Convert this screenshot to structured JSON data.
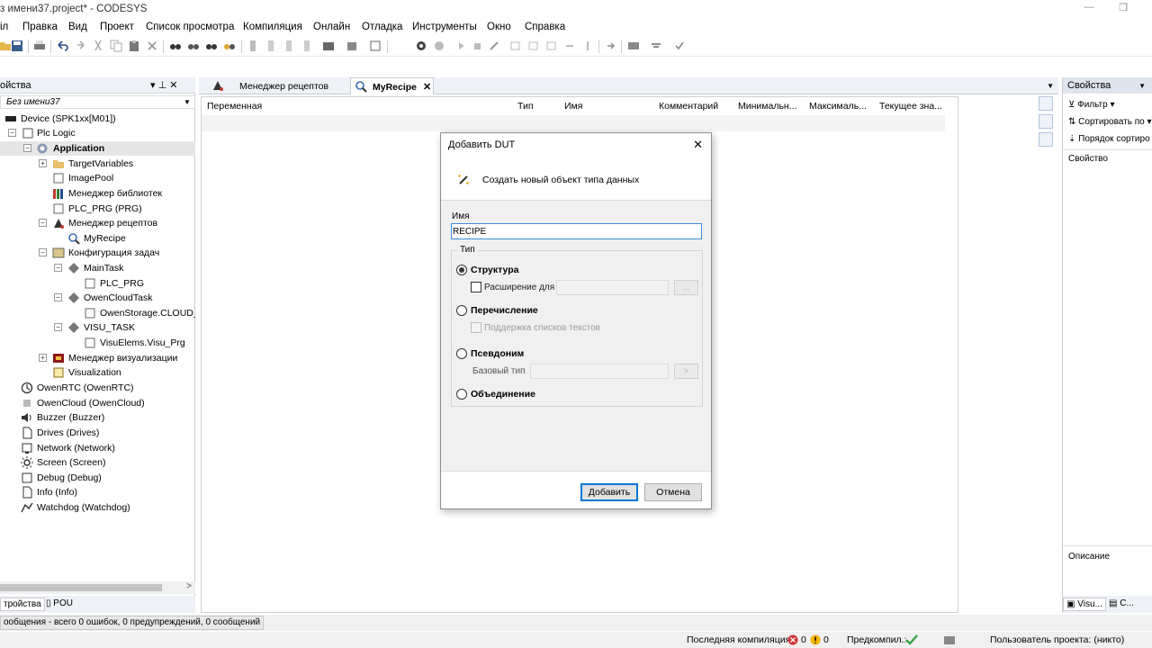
{
  "window": {
    "title": "з имени37.project* - CODESYS",
    "minimize": "—",
    "restore": "❐"
  },
  "menu": [
    "іл",
    "Правка",
    "Вид",
    "Проект",
    "Список просмотра",
    "Компиляция",
    "Онлайн",
    "Отладка",
    "Инструменты",
    "Окно",
    "Справка"
  ],
  "left_pane": {
    "title": "ойства",
    "pin": "▾  ⊥  ✕",
    "tree_root": "Без имени37",
    "nodes": [
      {
        "label": "Device (SPK1xx[M01])"
      },
      {
        "label": "Plc Logic"
      },
      {
        "label": "Application"
      },
      {
        "label": "TargetVariables"
      },
      {
        "label": "ImagePool"
      },
      {
        "label": "Менеджер библиотек"
      },
      {
        "label": "PLC_PRG (PRG)"
      },
      {
        "label": "Менеджер рецептов"
      },
      {
        "label": "MyRecipe"
      },
      {
        "label": "Конфигурация задач"
      },
      {
        "label": "MainTask"
      },
      {
        "label": "PLC_PRG"
      },
      {
        "label": "OwenCloudTask"
      },
      {
        "label": "OwenStorage.CLOUD_PR"
      },
      {
        "label": "VISU_TASK"
      },
      {
        "label": "VisuElems.Visu_Prg"
      },
      {
        "label": "Менеджер визуализации"
      },
      {
        "label": "Visualization"
      },
      {
        "label": "OwenRTC (OwenRTC)"
      },
      {
        "label": "OwenCloud (OwenCloud)"
      },
      {
        "label": "Buzzer (Buzzer)"
      },
      {
        "label": "Drives (Drives)"
      },
      {
        "label": "Network (Network)"
      },
      {
        "label": "Screen (Screen)"
      },
      {
        "label": "Debug (Debug)"
      },
      {
        "label": "Info (Info)"
      },
      {
        "label": "Watchdog (Watchdog)"
      }
    ],
    "tabs": [
      "тройства",
      "POU"
    ]
  },
  "editor": {
    "tabs": [
      {
        "label": "Менеджер рецептов",
        "active": false
      },
      {
        "label": "MyRecipe",
        "active": true
      }
    ],
    "tab_close": "✕",
    "columns": [
      "Переменная",
      "Тип",
      "Имя",
      "Комментарий",
      "Минимальн...",
      "Максималь...",
      "Текущее зна..."
    ]
  },
  "right_pane": {
    "title": "Свойства",
    "items": [
      "Фильтр ▾",
      "Сортировать по ▾",
      "Порядок сортиро"
    ],
    "list_header": "Свойство",
    "description_label": "Описание",
    "tabs": [
      "Visu...",
      "С..."
    ]
  },
  "dialog": {
    "title": "Добавить DUT",
    "close": "✕",
    "subtitle": "Создать новый объект типа данных",
    "name_label": "Имя",
    "name_value": "RECIPE",
    "type_legend": "Тип",
    "options": {
      "structure": "Структура",
      "extends": "Расширение для",
      "enum": "Перечисление",
      "text_list": "Поддержка списков текстов",
      "alias": "Псевдоним",
      "base_type": "Базовый тип",
      "union": "Объединение"
    },
    "browse": "...",
    "arrow": ">",
    "add_button": "Добавить",
    "cancel_button": "Отмена"
  },
  "messages": "ообщения - всего 0 ошибок, 0 предупреждений, 0 сообщений",
  "status": {
    "last_compile": "Последняя компиляция:",
    "errors": "0",
    "warnings": "0",
    "precompile": "Предкомпил.:",
    "project_user": "Пользователь проекта: (никто)"
  },
  "colors": {
    "accent": "#0078d7",
    "pane_header": "#eef1f5",
    "error": "#d32f2f",
    "warning": "#f2b400",
    "ok": "#2e9e3a"
  }
}
